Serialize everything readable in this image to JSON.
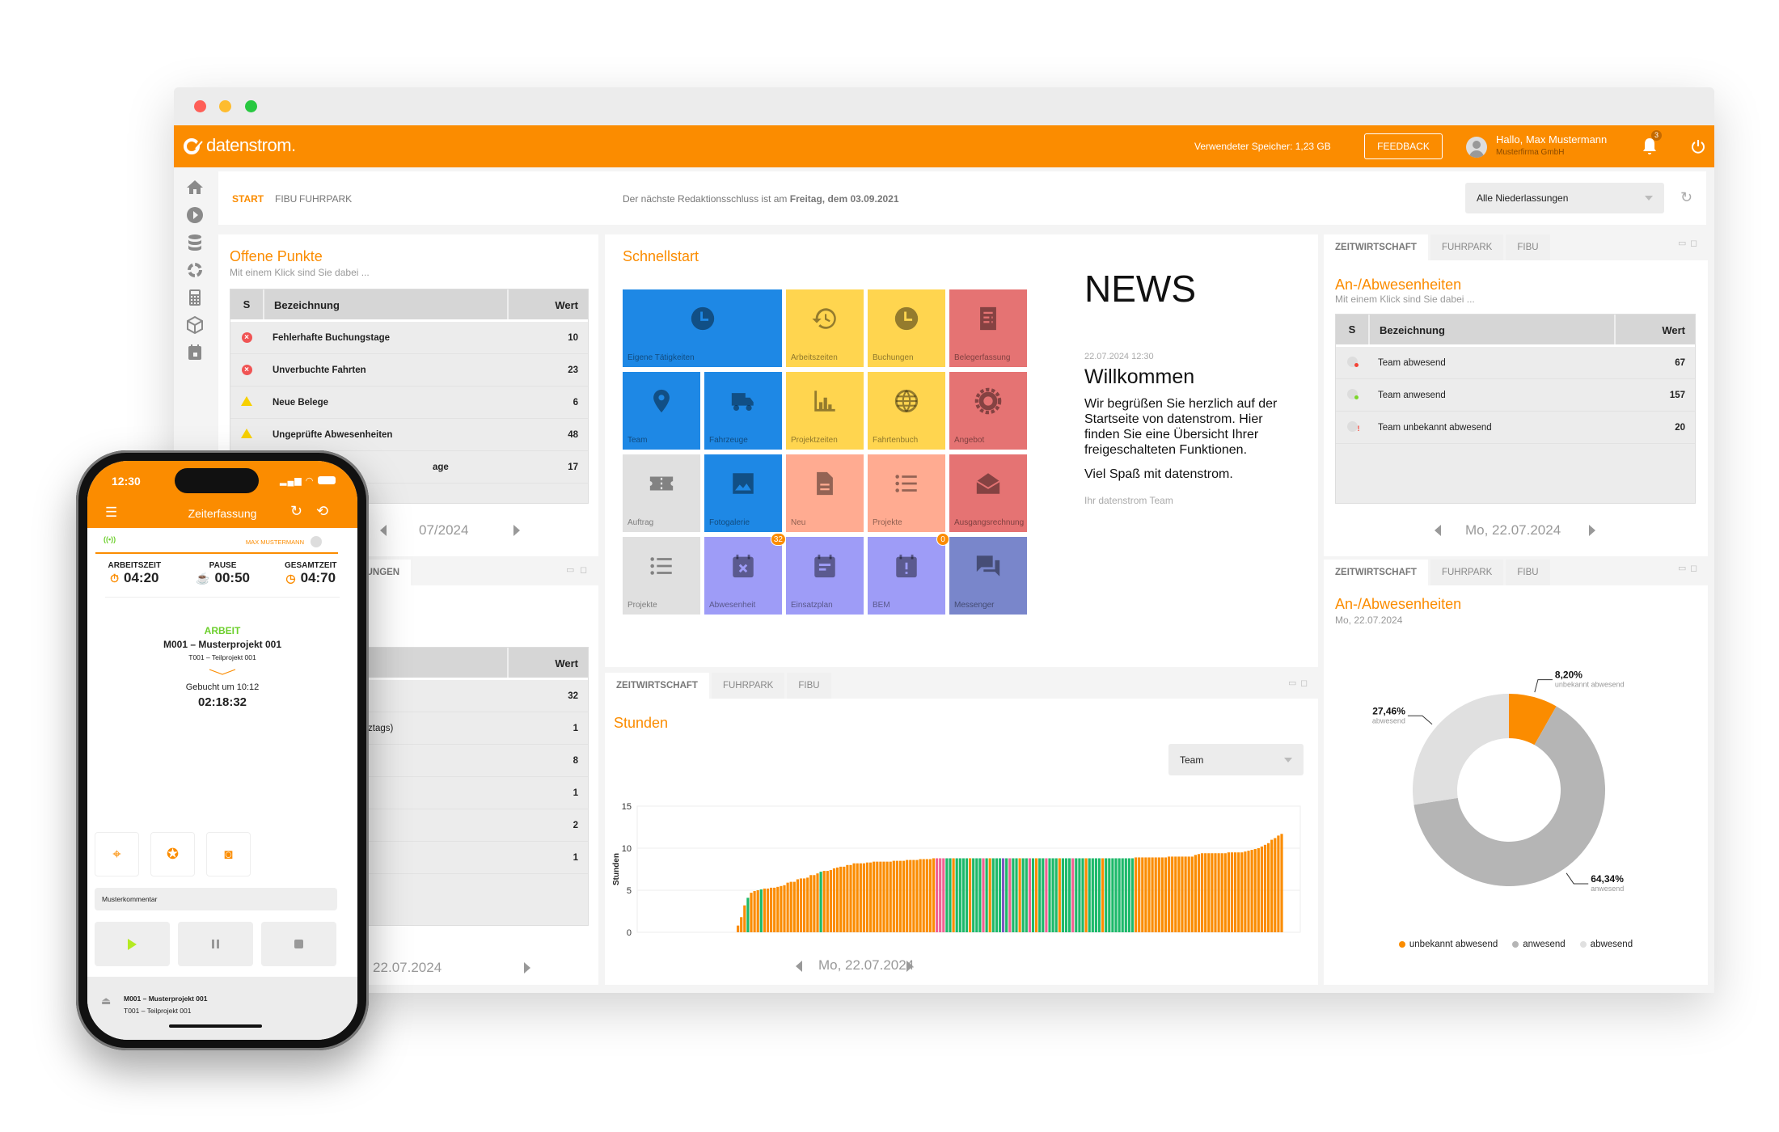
{
  "window": {
    "traffic_lights": [
      "#fe5f57",
      "#febc2e",
      "#28c840"
    ]
  },
  "colors": {
    "brand": "#fb8c00",
    "background": "#f4f4f4",
    "table_header": "#d6d6d6"
  },
  "header": {
    "logo": "datenstrom.",
    "storage": "Verwendeter Speicher: 1,23 GB",
    "feedback": "FEEDBACK",
    "greeting": "Hallo, Max Mustermann",
    "company": "Musterfirma GmbH",
    "notification_count": "3"
  },
  "sidebar": {
    "items": [
      "home-icon",
      "play-icon",
      "database-icon",
      "cycle-icon",
      "calculator-icon",
      "cube-icon",
      "calendar-icon"
    ]
  },
  "topnav": {
    "tabs": [
      "START",
      "FIBU",
      "FUHRPARK"
    ],
    "notice_prefix": "Der nächste Redaktionsschluss ist am ",
    "notice_bold": "Freitag, dem 03.09.2021",
    "branch_select": "Alle Niederlassungen"
  },
  "offene_punkte": {
    "title": "Offene Punkte",
    "subtitle": "Mit einem Klick sind Sie dabei ...",
    "columns": [
      "S",
      "Bezeichnung",
      "Wert"
    ],
    "rows": [
      {
        "status": "error",
        "label": "Fehlerhafte Buchungstage",
        "value": "10"
      },
      {
        "status": "error",
        "label": "Unverbuchte Fahrten",
        "value": "23"
      },
      {
        "status": "warning",
        "label": "Neue Belege",
        "value": "6"
      },
      {
        "status": "warning",
        "label": "Ungeprüfte Abwesenheiten",
        "value": "48"
      },
      {
        "status": "",
        "label": "age",
        "value": "17"
      }
    ],
    "pager": "07/2024"
  },
  "meldungen": {
    "tab": "MELDUNGEN",
    "column_wert": "Wert",
    "rows": [
      {
        "label": "",
        "value": "32"
      },
      {
        "label": "ztags)",
        "value": "1"
      },
      {
        "label": "",
        "value": "8"
      },
      {
        "label": "",
        "value": "1"
      },
      {
        "label": "",
        "value": "2"
      },
      {
        "label": "",
        "value": "1"
      }
    ],
    "pager": "Mo, 22.07.2024"
  },
  "schnellstart": {
    "title": "Schnellstart",
    "tiles": [
      {
        "label": "Eigene Tätigkeiten",
        "icon": "clock",
        "color": "#1e88e5",
        "span": 2
      },
      {
        "label": "Arbeitszeiten",
        "icon": "history",
        "color": "#ffd54f"
      },
      {
        "label": "Buchungen",
        "icon": "clock",
        "color": "#ffd54f"
      },
      {
        "label": "Belegerfassung",
        "icon": "receipt",
        "color": "#e57373"
      },
      {
        "label": "Team",
        "icon": "pin",
        "color": "#1e88e5"
      },
      {
        "label": "Fahrzeuge",
        "icon": "truck",
        "color": "#1e88e5"
      },
      {
        "label": "Projektzeiten",
        "icon": "bars",
        "color": "#ffd54f"
      },
      {
        "label": "Fahrtenbuch",
        "icon": "globe",
        "color": "#ffd54f"
      },
      {
        "label": "Angebot",
        "icon": "gear",
        "color": "#e57373"
      },
      {
        "label": "Auftrag",
        "icon": "ticket",
        "color": "#e0e0e0"
      },
      {
        "label": "Fotogalerie",
        "icon": "image",
        "color": "#1e88e5"
      },
      {
        "label": "Neu",
        "icon": "doc",
        "color": "#ffab91"
      },
      {
        "label": "Projekte",
        "icon": "list",
        "color": "#ffab91"
      },
      {
        "label": "Ausgangsrechnung",
        "icon": "mail",
        "color": "#e57373"
      },
      {
        "label": "Projekte",
        "icon": "list",
        "color": "#e0e0e0"
      },
      {
        "label": "Abwesenheit",
        "icon": "cal-x",
        "color": "#9e9cf7",
        "badge": "32"
      },
      {
        "label": "Einsatzplan",
        "icon": "cal-note",
        "color": "#9e9cf7"
      },
      {
        "label": "BEM",
        "icon": "cal-alert",
        "color": "#9e9cf7",
        "badge": "0"
      },
      {
        "label": "Messenger",
        "icon": "chat",
        "color": "#7986cb"
      }
    ]
  },
  "news": {
    "heading": "NEWS",
    "date": "22.07.2024 12:30",
    "title": "Willkommen",
    "body": "Wir begrüßen Sie herzlich auf der Startseite von datenstrom. Hier finden Sie eine Übersicht Ihrer freigeschalteten Funktionen.",
    "closing": "Viel Spaß mit datenstrom.",
    "signature": "Ihr datenstrom Team"
  },
  "panel_tabs": [
    "ZEITWIRTSCHAFT",
    "FUHRPARK",
    "FIBU"
  ],
  "stunden": {
    "title": "Stunden",
    "select": "Team",
    "pager": "Mo, 22.07.2024"
  },
  "anwesenheit_table": {
    "title": "An-/Abwesenheiten",
    "subtitle": "Mit einem Klick sind Sie dabei ...",
    "columns": [
      "S",
      "Bezeichnung",
      "Wert"
    ],
    "rows": [
      {
        "status": "#f44336",
        "label": "Team abwesend",
        "value": "67"
      },
      {
        "status": "#7cd62b",
        "label": "Team anwesend",
        "value": "157"
      },
      {
        "status": "#f44336",
        "label": "Team unbekannt abwesend",
        "value": "20"
      }
    ],
    "pager": "Mo, 22.07.2024"
  },
  "anwesenheit_chart": {
    "title": "An-/Abwesenheiten",
    "subtitle": "Mo, 22.07.2024"
  },
  "chart_data": [
    {
      "type": "bar",
      "ylabel": "Stunden",
      "ylim": [
        0,
        15
      ],
      "yticks": [
        0,
        5,
        10,
        15
      ],
      "grid": true,
      "palette": {
        "default": "#fb8c00",
        "green": "#1db96a",
        "pink": "#f06292",
        "purple": "#7e57c2"
      },
      "highlight": {
        "green": [
          33,
          37,
          55,
          93,
          94,
          96,
          97,
          98,
          99,
          101,
          102,
          103,
          105,
          107,
          108,
          109,
          111,
          113,
          114,
          116,
          117,
          119,
          121,
          122,
          124,
          125,
          126,
          128,
          129,
          130,
          132,
          133,
          134,
          136,
          137,
          138,
          139,
          141,
          142,
          143,
          144,
          145,
          146,
          147,
          148,
          149
        ],
        "pink": [
          90,
          91,
          92,
          104,
          112,
          118,
          123,
          131
        ],
        "purple": [
          110
        ]
      },
      "values": [
        0,
        0,
        0,
        0,
        0,
        0,
        0,
        0,
        0,
        0,
        0,
        0,
        0,
        0,
        0,
        0,
        0,
        0,
        0,
        0,
        0,
        0,
        0,
        0,
        0,
        0,
        0,
        0,
        0,
        0,
        0.8,
        1.8,
        3.2,
        4.1,
        4.7,
        4.9,
        5.0,
        5.1,
        5.2,
        5.2,
        5.3,
        5.3,
        5.4,
        5.5,
        5.6,
        5.9,
        6.0,
        6.0,
        6.3,
        6.4,
        6.4,
        6.5,
        6.8,
        6.8,
        7.0,
        7.2,
        7.3,
        7.3,
        7.4,
        7.6,
        7.7,
        7.8,
        7.8,
        8.0,
        8.0,
        8.2,
        8.2,
        8.2,
        8.2,
        8.3,
        8.3,
        8.4,
        8.4,
        8.4,
        8.4,
        8.4,
        8.4,
        8.5,
        8.5,
        8.5,
        8.5,
        8.6,
        8.6,
        8.6,
        8.6,
        8.7,
        8.7,
        8.7,
        8.7,
        8.8,
        8.8,
        8.8,
        8.8,
        8.8,
        8.8,
        8.8,
        8.8,
        8.8,
        8.8,
        8.8,
        8.8,
        8.8,
        8.8,
        8.8,
        8.8,
        8.8,
        8.8,
        8.8,
        8.8,
        8.8,
        8.8,
        8.8,
        8.8,
        8.8,
        8.8,
        8.8,
        8.8,
        8.8,
        8.8,
        8.8,
        8.8,
        8.8,
        8.8,
        8.8,
        8.8,
        8.8,
        8.8,
        8.8,
        8.8,
        8.8,
        8.8,
        8.8,
        8.8,
        8.8,
        8.8,
        8.8,
        8.8,
        8.8,
        8.8,
        8.8,
        8.8,
        8.8,
        8.8,
        8.8,
        8.8,
        8.8,
        8.8,
        8.8,
        8.8,
        8.8,
        8.9,
        8.9,
        8.9,
        8.9,
        8.9,
        8.9,
        8.9,
        8.9,
        8.9,
        8.9,
        9.0,
        9.0,
        9.0,
        9.0,
        9.0,
        9.0,
        9.0,
        9.0,
        9.2,
        9.3,
        9.4,
        9.4,
        9.4,
        9.4,
        9.4,
        9.4,
        9.4,
        9.4,
        9.5,
        9.5,
        9.5,
        9.5,
        9.5,
        9.6,
        9.7,
        9.8,
        9.9,
        10.0,
        10.2,
        10.4,
        10.6,
        11.0,
        11.2,
        11.5,
        11.7,
        0,
        0,
        0,
        0,
        0
      ]
    },
    {
      "type": "pie",
      "donut": true,
      "slices": [
        {
          "label": "unbekannt abwesend",
          "value": 8.2,
          "display": "8,20%",
          "color": "#fb8c00"
        },
        {
          "label": "anwesend",
          "value": 64.34,
          "display": "64,34%",
          "color": "#b5b5b5"
        },
        {
          "label": "abwesend",
          "value": 27.46,
          "display": "27,46%",
          "color": "#e0e0e0"
        }
      ],
      "legend": "bottom"
    }
  ],
  "phone": {
    "time": "12:30",
    "title": "Zeiterfassung",
    "user": "MAX MUSTERMANN",
    "stats": [
      {
        "label": "ARBEITSZEIT",
        "value": "04:20",
        "icon": "stopwatch-icon"
      },
      {
        "label": "PAUSE",
        "value": "00:50",
        "icon": "coffee-icon"
      },
      {
        "label": "GESAMTZEIT",
        "value": "04:70",
        "icon": "clock-icon"
      }
    ],
    "state": "ARBEIT",
    "project": "M001 – Musterprojekt 001",
    "subproject": "T001 – Teilprojekt 001",
    "booked": "Gebucht um 10:12",
    "timer": "02:18:32",
    "comment": "Musterkommentar",
    "footer_project": "M001 – Musterprojekt 001",
    "footer_subproject": "T001 – Teilprojekt 001"
  }
}
